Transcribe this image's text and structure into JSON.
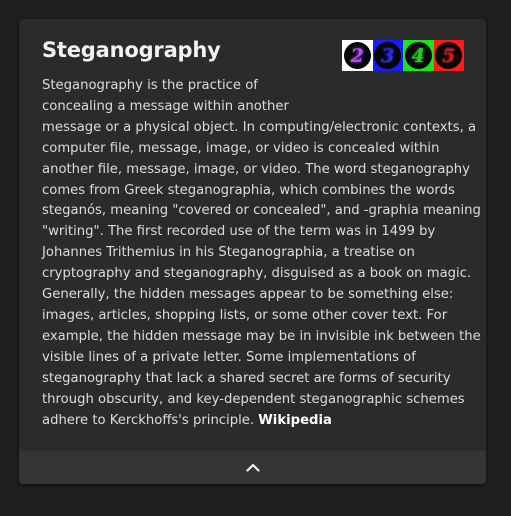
{
  "infobox": {
    "title": "Steganography",
    "images": [
      {
        "icon": "steganography-example-2-icon",
        "glyph": "2",
        "border": "#ffffff",
        "glyph_color": "#b04cf0"
      },
      {
        "icon": "steganography-example-3-icon",
        "glyph": "3",
        "border": "#1a1aff",
        "glyph_color": "#2a2aee"
      },
      {
        "icon": "steganography-example-4-icon",
        "glyph": "4",
        "border": "#19e619",
        "glyph_color": "#29cc29"
      },
      {
        "icon": "steganography-example-5-icon",
        "glyph": "5",
        "border": "#ff1a1a",
        "glyph_color": "#cc2020"
      }
    ],
    "lines_short": [
      "Steganography is the practice of",
      "concealing a message within another"
    ],
    "text_rest": "message or a physical object. In computing/electronic contexts, a computer file, message, image, or video is concealed within another file, message, image, or video. The word steganography comes from Greek steganographia, which combines the words steganós, meaning \"covered or concealed\", and -graphia meaning \"writing\". The first recorded use of the term was in 1499 by Johannes Trithemius in his Steganographia, a treatise on cryptography and steganography, disguised as a book on magic. Generally, the hidden messages appear to be something else: images, articles, shopping lists, or some other cover text. For example, the hidden message may be in invisible ink between the visible lines of a private letter. Some implementations of steganography that lack a shared secret are forms of security through obscurity, and key-dependent steganographic schemes adhere to Kerckhoffs's principle.",
    "source_link": "Wikipedia",
    "collapse_icon": "chevron-up-icon"
  }
}
